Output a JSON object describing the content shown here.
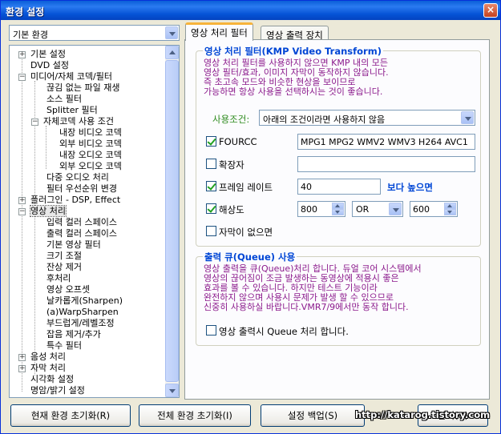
{
  "window": {
    "title": "환경 설정",
    "close_label": "×"
  },
  "preset_combo": {
    "value": "기본 환경"
  },
  "tree": [
    {
      "label": "기본 설정"
    },
    {
      "label": "DVD 설정"
    },
    {
      "label": "미디어/자체 코덱/필터"
    },
    {
      "label": "끊김 없는 파일 재생"
    },
    {
      "label": "소스 필터"
    },
    {
      "label": "Splitter 필터"
    },
    {
      "label": "자체코덱 사용 조건"
    },
    {
      "label": "내장 비디오 코덱"
    },
    {
      "label": "외부 비디오 코덱"
    },
    {
      "label": "내장 오디오 코덱"
    },
    {
      "label": "외부 오디오 코덱"
    },
    {
      "label": "다중 오디오 처리"
    },
    {
      "label": "필터 우선순위 변경"
    },
    {
      "label": "플러그인 - DSP, Effect"
    },
    {
      "label": "영상 처리"
    },
    {
      "label": "입력 컬러 스페이스"
    },
    {
      "label": "출력 컬러 스페이스"
    },
    {
      "label": "기본 영상 필터"
    },
    {
      "label": "크기 조절"
    },
    {
      "label": "잔상 제거"
    },
    {
      "label": "후처리"
    },
    {
      "label": "영상 오프셋"
    },
    {
      "label": "날카롭게(Sharpen)"
    },
    {
      "label": "(a)WarpSharpen"
    },
    {
      "label": "부드럽게/레벨조정"
    },
    {
      "label": "잡음 제거/추가"
    },
    {
      "label": "특수 필터"
    },
    {
      "label": "음성 처리"
    },
    {
      "label": "자막 처리"
    },
    {
      "label": "시각화 설정"
    },
    {
      "label": "명암/밝기 설정"
    }
  ],
  "tabs": [
    {
      "label": "영상 처리 필터"
    },
    {
      "label": "영상 출력 장치"
    }
  ],
  "filter_group": {
    "title": "영상 처리 필터(KMP Video Transform)",
    "description": [
      "영상 처리 필터를 사용하지 않으면 KMP 내의 모든",
      "영상 필터/효과, 이미지 자막이 동작하지 않습니다.",
      "즉 초고속 모드와 비슷한 현상을 보이므로",
      "가능하면 항상 사용을 선택하시는 것이 좋습니다."
    ],
    "condition_label": "사용조건:",
    "condition_value": "아래의 조건이라면 사용하지 않음",
    "fourcc": {
      "label": "FOURCC",
      "checked": true,
      "value": "MPG1 MPG2 WMV2 WMV3 H264 AVC1"
    },
    "extension": {
      "label": "확장자",
      "checked": false,
      "value": ""
    },
    "framerate": {
      "label": "프레임 레이트",
      "checked": true,
      "value": "40",
      "suffix": "보다 높으면"
    },
    "resolution": {
      "label": "해상도",
      "checked": true,
      "width": "800",
      "op": "OR",
      "height": "600"
    },
    "no_subtitle": {
      "label": "자막이 없으면",
      "checked": false
    }
  },
  "queue_group": {
    "title": "출력 큐(Queue) 사용",
    "description": [
      "영상 출력을 큐(Queue)처리 합니다. 듀얼 코어 시스템에서",
      "영상의 끊어짐이 조금 발생하는 동영상에 적용시 좋은",
      "효과를 볼 수 있습니다. 하지만 테스트 기능이라",
      "완전하지 않으며 사용시 문제가 발생 할 수 있으므로",
      "신중히 사용하실 바랍니다.VMR7/9에서만 동작 합니다."
    ],
    "queue_checkbox": {
      "label": "영상 출력시 Queue 처리 합니다.",
      "checked": false
    }
  },
  "buttons": {
    "reset_current": "현재 환경 초기화(R)",
    "reset_all": "전체 환경 초기화(I)",
    "backup": "설정 백업(S)",
    "close": "닫기(C)"
  },
  "watermark": "http://katarog.tistory.com"
}
